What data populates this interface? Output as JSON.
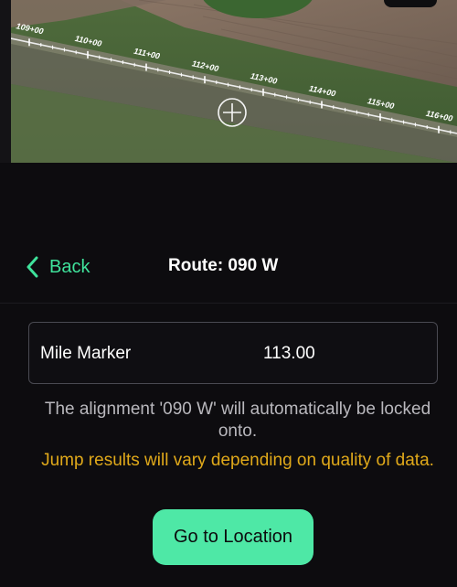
{
  "map": {
    "station_labels": [
      "109+00",
      "110+00",
      "111+00",
      "112+00",
      "113+00",
      "114+00",
      "115+00",
      "116+00"
    ],
    "colors": {
      "field_green": "#4c6a3a",
      "soil": "#7d6a5a",
      "road": "#5c5a55"
    }
  },
  "nav": {
    "back_label": "Back",
    "title": "Route: 090 W"
  },
  "mile_marker": {
    "label": "Mile Marker",
    "value": "113.00"
  },
  "messages": {
    "info": "The alignment '090 W' will automatically be locked onto.",
    "warning": "Jump results will vary depending on quality of data."
  },
  "actions": {
    "go_label": "Go to Location"
  },
  "colors": {
    "accent": "#3fe29b",
    "button": "#4ee8a6",
    "warning": "#e0a91a",
    "background": "#0d0c0f"
  }
}
